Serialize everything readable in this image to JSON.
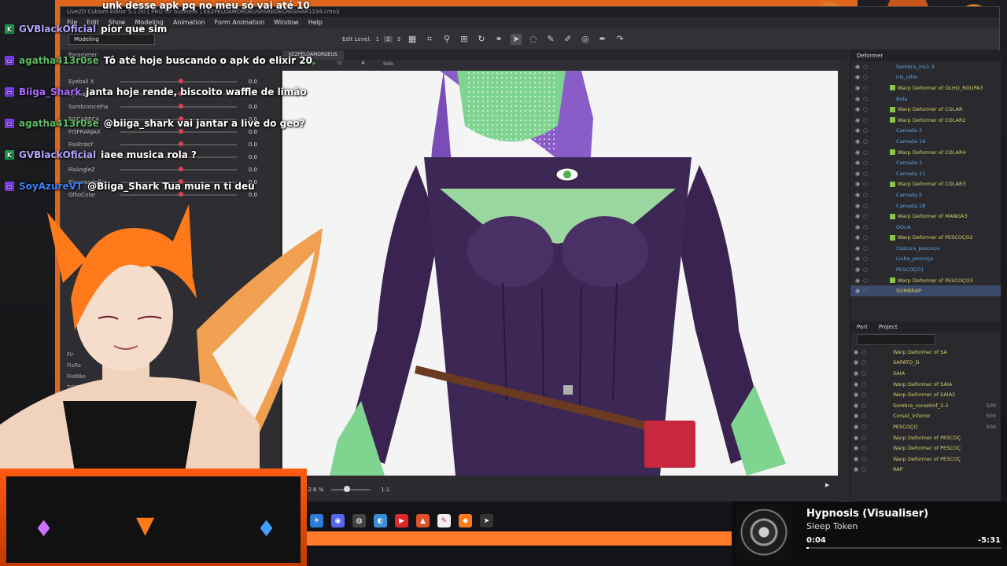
{
  "editor": {
    "title": "Live2D Cubism Editor 5.1.00   [ PRO for business ]   KEZPELOAMORDEUSPAREDECRASHAR1234.cmo3",
    "menu": [
      "File",
      "Edit",
      "Show",
      "Modeling",
      "Animation",
      "Form Animation",
      "Window",
      "Help"
    ],
    "mode_dropdown": "Modeling",
    "edit_level_label": "Edit Level:",
    "edit_levels": [
      "1",
      "2",
      "3"
    ]
  },
  "parameters": {
    "panel_title": "Parameter",
    "rows": [
      {
        "name": "Eyeball X",
        "value": "0.0",
        "level": 0.5
      },
      {
        "name": "Eyeball Y",
        "value": "0.0",
        "level": 0.5
      },
      {
        "name": "Sombrancelha",
        "value": "0.0",
        "level": 0.5
      },
      {
        "name": "FISCABEÇA",
        "value": "0.0",
        "level": 0.5
      },
      {
        "name": "FISFRANJAX",
        "value": "0.0",
        "level": 0.5
      },
      {
        "name": "FisAtrásY",
        "value": "0.0",
        "level": 0.5
      },
      {
        "name": "FisAtrásX",
        "value": "0.0",
        "level": 0.5
      },
      {
        "name": "FisAngleZ",
        "value": "0.0",
        "level": 0.5
      },
      {
        "name": "Fiscoroadeflor",
        "value": "0.0",
        "level": 0.5
      },
      {
        "name": "OlhoColar",
        "value": "0.0",
        "level": 0.5
      }
    ],
    "lower_items": [
      "Fir",
      "FisRo",
      "FisMão",
      "TOGGLE"
    ]
  },
  "canvas": {
    "tab_label": "KEZPELOAMORDEUS",
    "solo_label": "Solo",
    "zoom_label": "12.6 %",
    "ratio_label": "1:1"
  },
  "deformer": {
    "panel_title": "Deformer",
    "items": [
      {
        "label": "Sombra_iris1-3",
        "kind": "art"
      },
      {
        "label": "iris_olho",
        "kind": "art"
      },
      {
        "label": "Warp Deformer of OLHO_ROUPA3",
        "kind": "warp"
      },
      {
        "label": "Bola",
        "kind": "art"
      },
      {
        "label": "Warp Deformer of COLAR",
        "kind": "warp"
      },
      {
        "label": "Warp Deformer of COLAR2",
        "kind": "warp"
      },
      {
        "label": "Camada 2",
        "kind": "art"
      },
      {
        "label": "Camada 19",
        "kind": "art"
      },
      {
        "label": "Warp Deformer of COLAR4",
        "kind": "warp"
      },
      {
        "label": "Camada 3",
        "kind": "art"
      },
      {
        "label": "Camada 11",
        "kind": "art"
      },
      {
        "label": "Warp Deformer of COLAR3",
        "kind": "warp"
      },
      {
        "label": "Camada 5",
        "kind": "art"
      },
      {
        "label": "Camada 18",
        "kind": "art"
      },
      {
        "label": "Warp Deformer of MANGA3",
        "kind": "warp"
      },
      {
        "label": "GOLA",
        "kind": "art"
      },
      {
        "label": "Warp Deformer of PESCOÇO2",
        "kind": "warp"
      },
      {
        "label": "Costura_pescoço",
        "kind": "art"
      },
      {
        "label": "Linha_pescoço",
        "kind": "art"
      },
      {
        "label": "PESCOÇO1",
        "kind": "art"
      },
      {
        "label": "Warp Deformer of PESCOÇO3",
        "kind": "warp"
      },
      {
        "label": "SOMBRAP",
        "kind": "sel"
      }
    ]
  },
  "parts": {
    "tabs": [
      "Part",
      "Project"
    ],
    "items": [
      {
        "label": "Warp Deformer of SA",
        "num": ""
      },
      {
        "label": "SAPATO_D",
        "num": ""
      },
      {
        "label": "SAIA",
        "num": ""
      },
      {
        "label": "Warp Deformer of SAIA",
        "num": ""
      },
      {
        "label": "Warp Deformer of SAIA2",
        "num": ""
      },
      {
        "label": "Sombra_corsetinf_2-2",
        "num": "500"
      },
      {
        "label": "Corset_inferior",
        "num": "500"
      },
      {
        "label": "PESCOÇO",
        "num": "500"
      },
      {
        "label": "Warp Deformer of PESCOÇ",
        "num": ""
      },
      {
        "label": "Warp Deformer of PESCOÇ",
        "num": ""
      },
      {
        "label": "Warp Deformer of PESCOÇ",
        "num": ""
      },
      {
        "label": "RAP",
        "num": ""
      }
    ]
  },
  "chat": [
    {
      "user": "GVBlackOficial",
      "text": "pior que sim",
      "color": "#b4a4ff",
      "badge": "K",
      "badge_color": "#16a34a"
    },
    {
      "user": "agatha413r0se",
      "text": "Tô até hoje buscando o apk do elixir 20",
      "color": "#5dbb63",
      "badge": "▭",
      "badge_color": "#7c3aed"
    },
    {
      "user": "Biiga_Shark",
      "text": "janta hoje rende, biscoito waffle de limão",
      "color": "#a96cff",
      "badge": "▭",
      "badge_color": "#7c3aed"
    },
    {
      "user": "agatha413r0se",
      "text": "@biiga_shark vai jantar a live do geo?",
      "color": "#5dbb63",
      "badge": "▭",
      "badge_color": "#7c3aed"
    },
    {
      "user": "GVBlackOficial",
      "text": "iaee musica rola ?",
      "color": "#b4a4ff",
      "badge": "K",
      "badge_color": "#16a34a"
    },
    {
      "user": "SoyAzureVT",
      "text": "@Biiga_Shark Tua muie n ti deu",
      "color": "#3b82f6",
      "badge": "▭",
      "badge_color": "#7c3aed"
    }
  ],
  "chat_top_fragment": "unk desse apk pq no meu só vai até 10",
  "music": {
    "title": "Hypnosis (Visualiser)",
    "artist": "Sleep Token",
    "elapsed": "0:04",
    "remaining": "-5:31",
    "progress": 0.012
  },
  "colors": {
    "frame_orange": "#e0651e",
    "accent_green": "#8bc34a"
  }
}
